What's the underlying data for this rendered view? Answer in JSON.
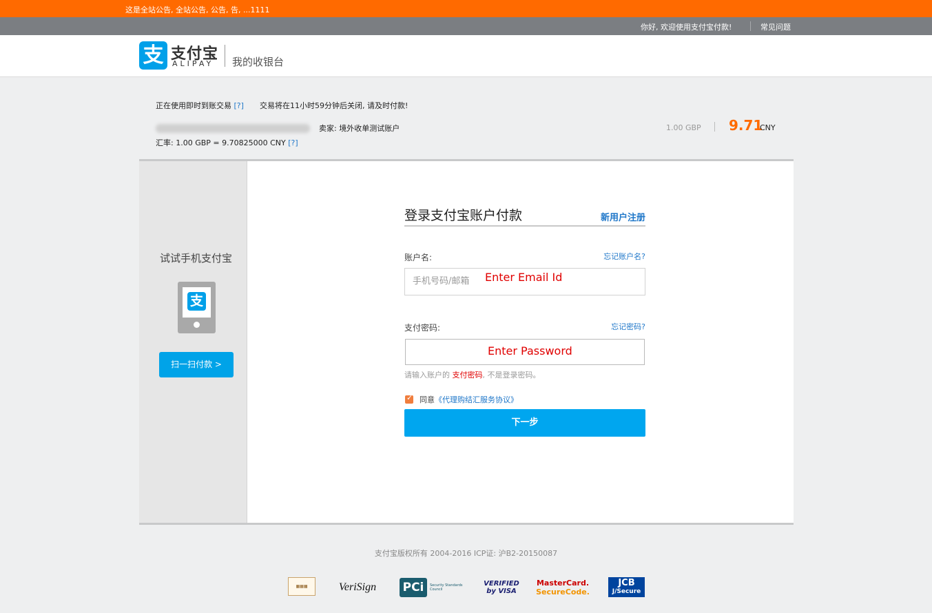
{
  "notice": {
    "text": "这是全站公告, 全站公告, 公告, 告, ...1111"
  },
  "topbar": {
    "greeting": "你好, 欢迎使用支付宝付款!",
    "faq": "常见问题"
  },
  "header": {
    "logo_glyph": "支",
    "logo_cn": "支付宝",
    "logo_en": "ALIPAY",
    "title": "我的收银台",
    "brand_color": "#00a0e9"
  },
  "order": {
    "mode": "正在使用即时到账交易",
    "help": "[?]",
    "timeout": "交易将在11小时59分钟后关闭, 请及时付款!",
    "seller": "卖家: 境外收单测试账户",
    "rate": "汇率: 1.00 GBP = 9.70825000 CNY",
    "rate_help": "[?]",
    "amount_gbp": "1.00 GBP",
    "amount_cny": "9.71",
    "amount_unit": "CNY"
  },
  "side": {
    "title": "试试手机支付宝",
    "phone_glyph": "支",
    "scan_button": "扫一扫付款 >"
  },
  "form": {
    "title": "登录支付宝账户付款",
    "register": "新用户注册",
    "account_label": "账户名:",
    "forgot_account": "忘记账户名?",
    "account_placeholder": "手机号码/邮箱",
    "account_overlay": "Enter Email Id",
    "password_label": "支付密码:",
    "forgot_password": "忘记密码?",
    "password_overlay": "Enter Password",
    "hint_prefix": "请输入账户的 ",
    "hint_emphasis": "支付密码",
    "hint_suffix": ", 不是登录密码。",
    "agree_prefix": "同意",
    "agree_link": "《代理购结汇服务协议》",
    "agree_checked": true,
    "next_button": "下一步"
  },
  "footer": {
    "copyright": "支付宝版权所有 2004-2016 ICP证: 沪B2-20150087",
    "badges": {
      "verisign": "VeriSign",
      "pci": "PCi",
      "pci_sub": "Security Standards Council",
      "visa_1": "VERIFIED",
      "visa_2": "by VISA",
      "mc_1": "MasterCard.",
      "mc_2": "SecureCode.",
      "jcb_1": "JCB",
      "jcb_2": "J/Secure"
    }
  }
}
